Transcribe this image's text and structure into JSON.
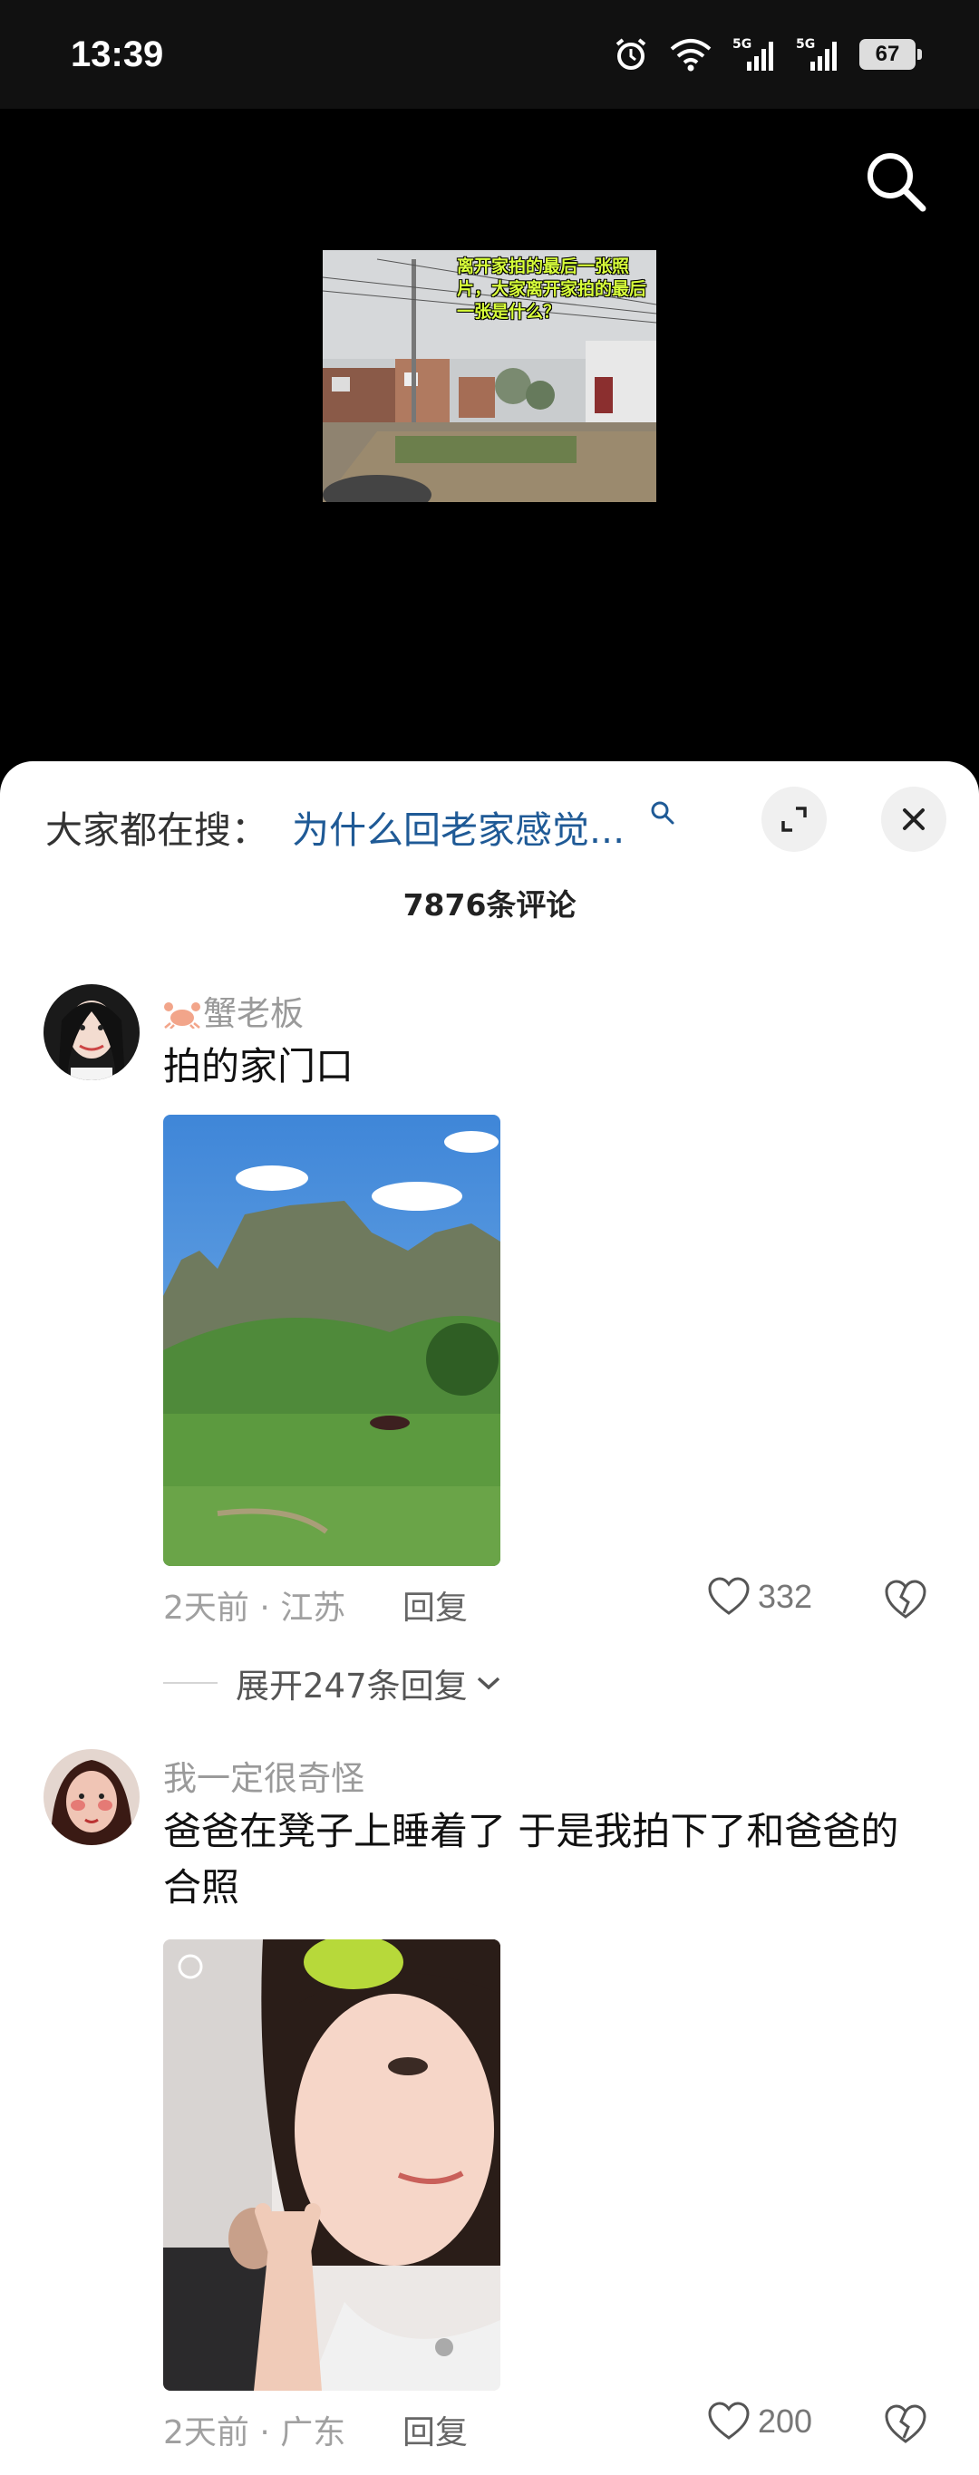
{
  "status_bar": {
    "time": "13:39",
    "icons": [
      "alarm-icon",
      "wifi-icon",
      "signal-5g-icon",
      "signal-5g-icon",
      "battery-icon"
    ],
    "battery_level": "67"
  },
  "video": {
    "caption": "离开家拍的最后一张照片，大家离开家拍的最后一张是什么？",
    "caption_color": "#d8ff3a"
  },
  "sheet": {
    "hot_search_label": "大家都在搜：",
    "hot_search_query": "为什么回老家感觉...",
    "comment_count": "7876条评论"
  },
  "comments": [
    {
      "username": "蟹老板",
      "text": "拍的家门口",
      "time": "2天前",
      "location": "江苏",
      "reply_label": "回复",
      "likes": "332",
      "expand_label": "展开247条回复"
    },
    {
      "username": "我一定很奇怪",
      "text": "爸爸在凳子上睡着了 于是我拍下了和爸爸的合照",
      "time": "2天前",
      "location": "广东",
      "reply_label": "回复",
      "likes": "200"
    }
  ],
  "colors": {
    "link_blue": "#1f5a96",
    "meta_gray": "#a0a0a0",
    "sheet_bg": "#ffffff"
  }
}
